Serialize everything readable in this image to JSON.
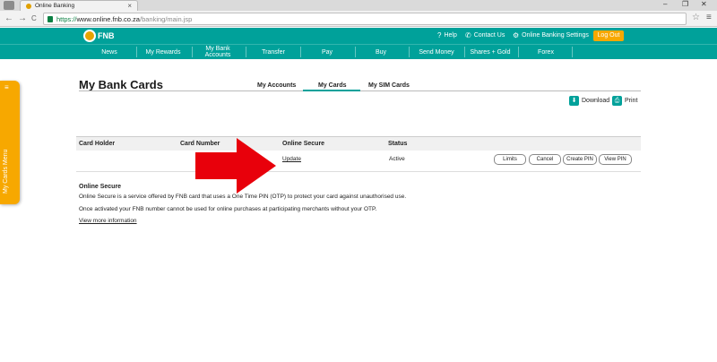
{
  "browser": {
    "tab_title": "Online Banking",
    "tab_close": "×",
    "window_controls": [
      "–",
      "❐",
      "✕"
    ],
    "nav": [
      "←",
      "→",
      "C"
    ],
    "url_scheme": "https://",
    "url_host": "www.online.fnb.co.za",
    "url_path": "/banking/main.jsp",
    "star_icon": "☆",
    "menu_icon": "≡"
  },
  "header": {
    "logo_text": "FNB",
    "help": "Help",
    "contact_us": "Contact Us",
    "settings": "Online Banking Settings",
    "logout": "Log Out"
  },
  "nav": {
    "items": [
      "News",
      "My Rewards",
      "My Bank Accounts",
      "Transfer",
      "Pay",
      "Buy",
      "Send Money",
      "Shares + Gold",
      "Forex"
    ]
  },
  "side_menu": {
    "label": "My Cards Menu",
    "icon": "≡"
  },
  "page": {
    "title": "My Bank Cards",
    "tabs": [
      "My Accounts",
      "My Cards",
      "My SIM Cards"
    ],
    "active_tab": "My Cards",
    "download": "Download",
    "print": "Print"
  },
  "table": {
    "headers": [
      "Card Holder",
      "Card Number",
      "Online Secure",
      "Status"
    ],
    "rows": [
      {
        "card_holder": "",
        "card_number": "",
        "online_secure": "Update",
        "status": "Active"
      }
    ],
    "actions": [
      "Limits",
      "Cancel",
      "Create PIN",
      "View PIN"
    ]
  },
  "info": {
    "heading": "Online Secure",
    "line1": "Online Secure is a service offered by FNB card that uses a One Time PIN (OTP) to protect your card against unauthorised use.",
    "line2": "Once activated your FNB number cannot be used for online purchases at participating merchants without your OTP.",
    "link": "View more information"
  },
  "colors": {
    "brand_teal": "#00a19a",
    "accent_orange": "#f7a800",
    "arrow_red": "#e8000b"
  }
}
